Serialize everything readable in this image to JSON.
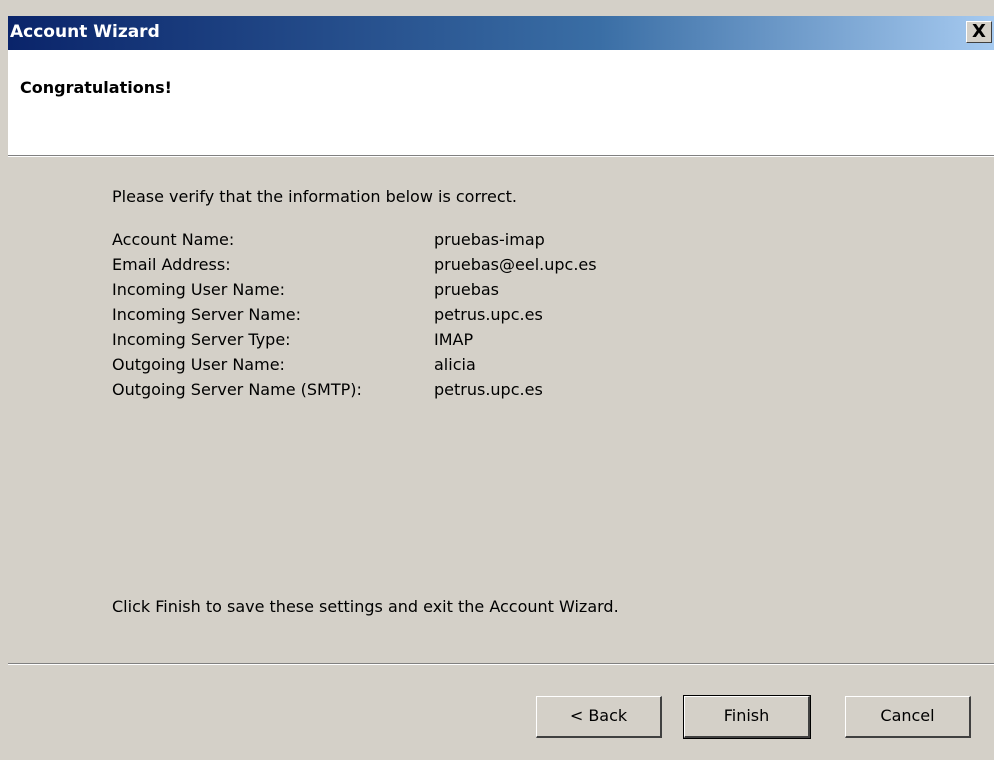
{
  "window": {
    "title": "Account Wizard",
    "close_label": "X"
  },
  "header": {
    "title": "Congratulations!"
  },
  "content": {
    "intro": "Please verify that the information below is correct.",
    "rows": [
      {
        "label": "Account Name:",
        "value": "pruebas-imap"
      },
      {
        "label": "Email Address:",
        "value": "pruebas@eel.upc.es"
      },
      {
        "label": "Incoming User Name:",
        "value": "pruebas"
      },
      {
        "label": "Incoming Server Name:",
        "value": "petrus.upc.es"
      },
      {
        "label": "Incoming Server Type:",
        "value": "IMAP"
      },
      {
        "label": "Outgoing User Name:",
        "value": "alicia"
      },
      {
        "label": "Outgoing Server Name (SMTP):",
        "value": "petrus.upc.es"
      }
    ],
    "footer": "Click Finish to save these settings and exit the Account Wizard."
  },
  "buttons": {
    "back": "< Back",
    "finish": "Finish",
    "cancel": "Cancel"
  },
  "colors": {
    "titlebar_start": "#0a246a",
    "titlebar_end": "#a6caf0",
    "dialog_background": "#d4d0c8",
    "header_background": "#ffffff"
  }
}
